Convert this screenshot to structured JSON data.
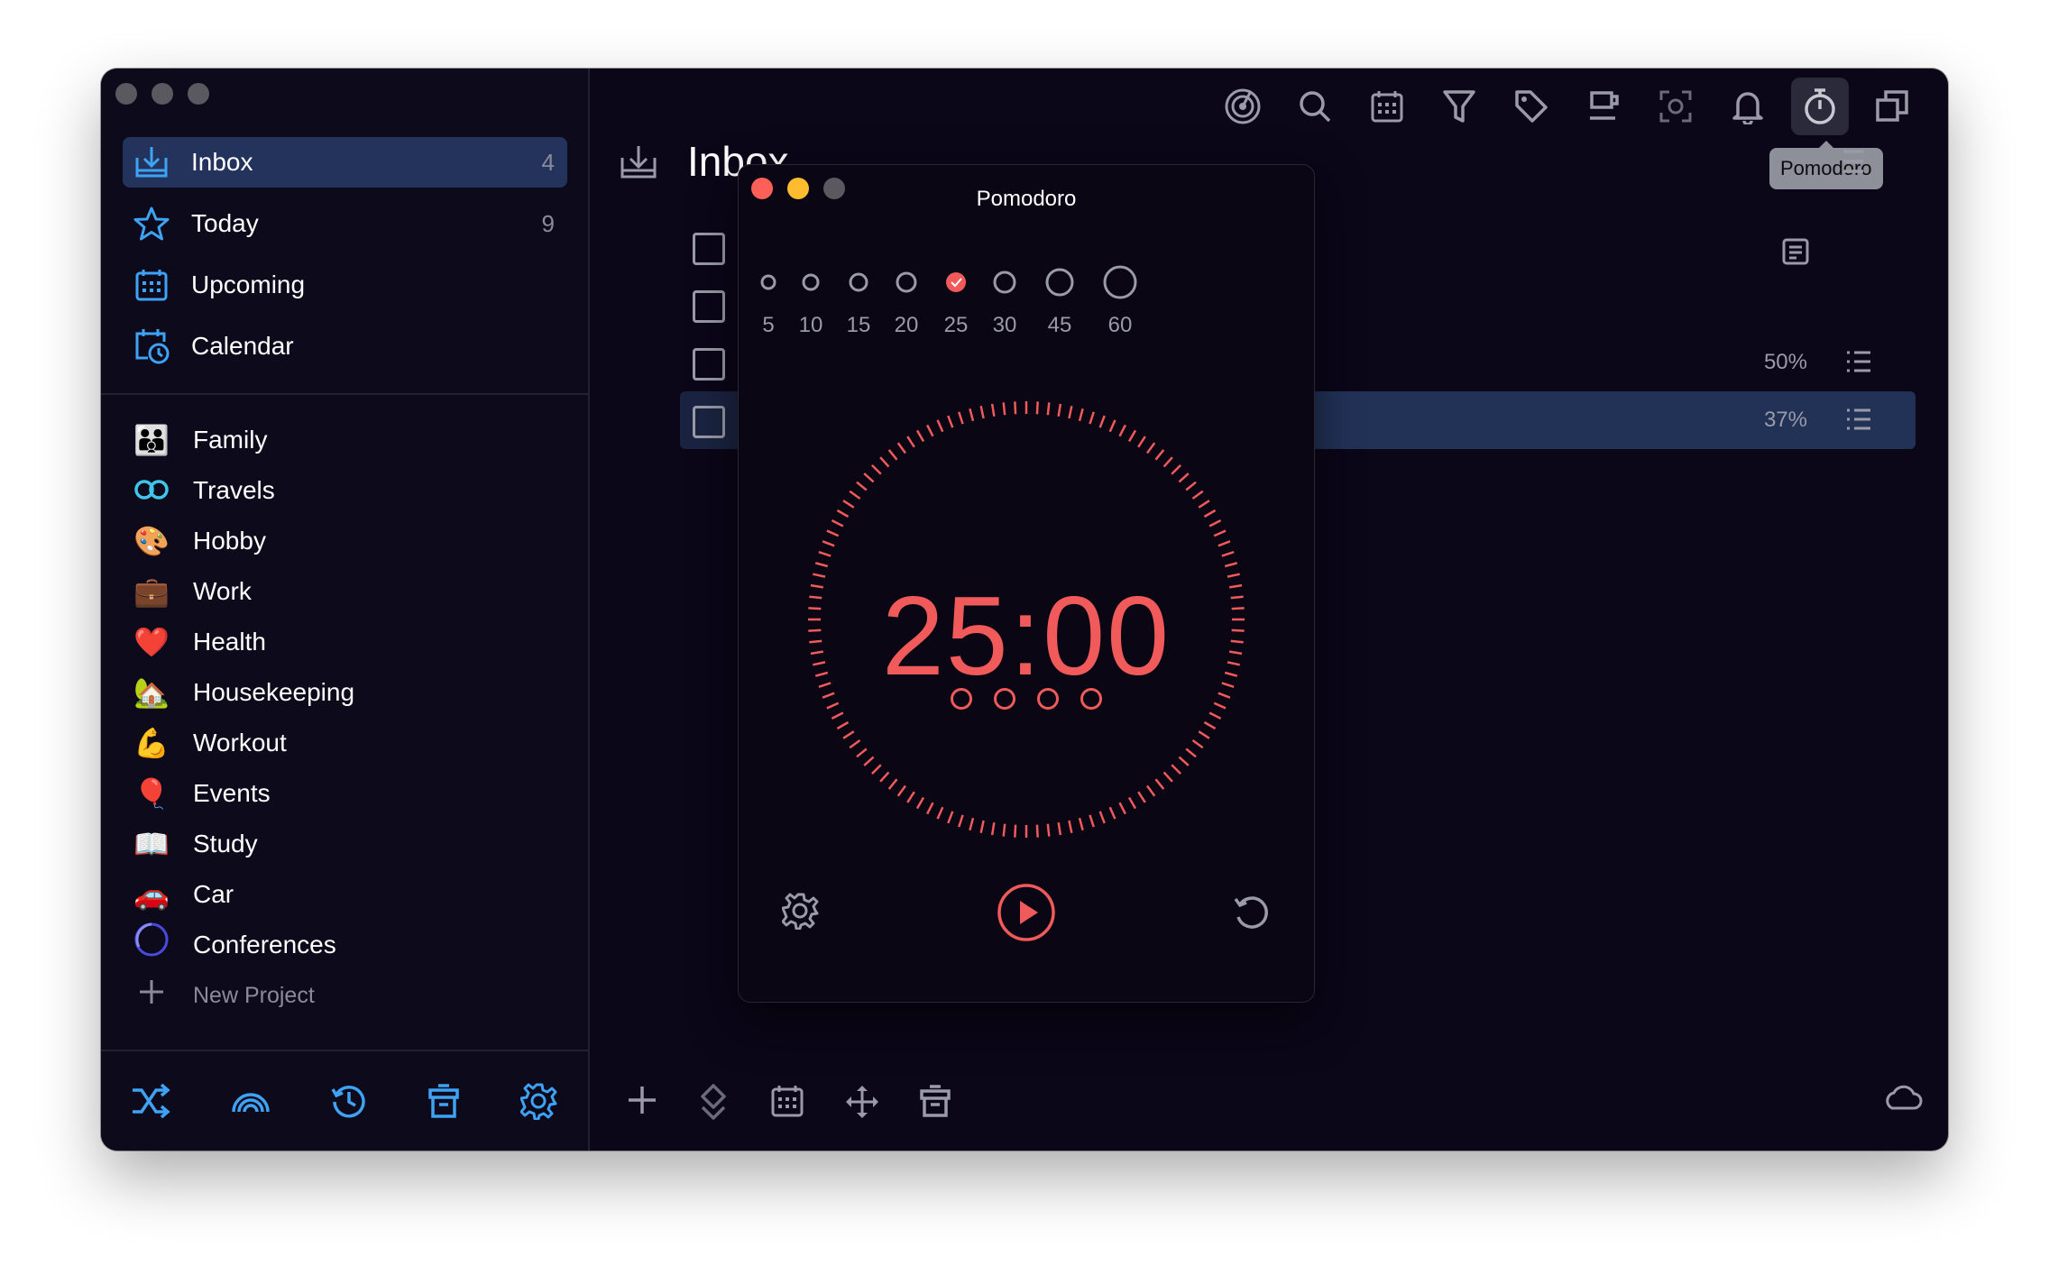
{
  "window_title": "Inbox",
  "sidebar": {
    "nav": [
      {
        "label": "Inbox",
        "count": "4",
        "icon": "inbox-icon"
      },
      {
        "label": "Today",
        "count": "9",
        "icon": "star-icon"
      },
      {
        "label": "Upcoming",
        "count": "",
        "icon": "calendar-grid-icon"
      },
      {
        "label": "Calendar",
        "count": "",
        "icon": "calendar-clock-icon"
      }
    ],
    "projects": [
      {
        "label": "Family",
        "emoji": "👪"
      },
      {
        "label": "Travels",
        "emoji": "♾"
      },
      {
        "label": "Hobby",
        "emoji": "🎨"
      },
      {
        "label": "Work",
        "emoji": "💼"
      },
      {
        "label": "Health",
        "emoji": "❤️"
      },
      {
        "label": "Housekeeping",
        "emoji": "🏡"
      },
      {
        "label": "Workout",
        "emoji": "💪"
      },
      {
        "label": "Events",
        "emoji": "🎈"
      },
      {
        "label": "Study",
        "emoji": "📖"
      },
      {
        "label": "Car",
        "emoji": "🚗"
      },
      {
        "label": "Conferences",
        "emoji": "◯"
      }
    ],
    "new_project": "New Project",
    "bottom_icons": [
      "shuffle-icon",
      "rainbow-icon",
      "history-icon",
      "trash-icon",
      "settings-icon"
    ]
  },
  "main": {
    "title": "Inbox",
    "toolbar_icons": [
      "focus-icon",
      "search-icon",
      "calendar-icon",
      "filter-icon",
      "tag-icon",
      "coffee-icon",
      "capture-icon",
      "bell-icon",
      "timer-icon",
      "copy-icon"
    ],
    "tooltip": "Pomodoro",
    "tasks": [
      {
        "percent": ""
      },
      {
        "percent": ""
      },
      {
        "percent": "50%"
      },
      {
        "percent": "37%"
      }
    ],
    "bottom_icons": [
      "add-icon",
      "priority-icon",
      "calendar-icon",
      "move-icon",
      "trash-icon"
    ],
    "cloud_icon": "cloud-icon"
  },
  "pomodoro": {
    "title": "Pomodoro",
    "durations": [
      "5",
      "10",
      "15",
      "20",
      "25",
      "30",
      "45",
      "60"
    ],
    "selected_duration": "25",
    "time": "25:00",
    "cycles": 4,
    "accent": "#f05a5a"
  },
  "colors": {
    "accent_blue": "#3fa3f5",
    "background": "#0b0618",
    "selection": "#23335c",
    "timer_red": "#f05a5a"
  }
}
